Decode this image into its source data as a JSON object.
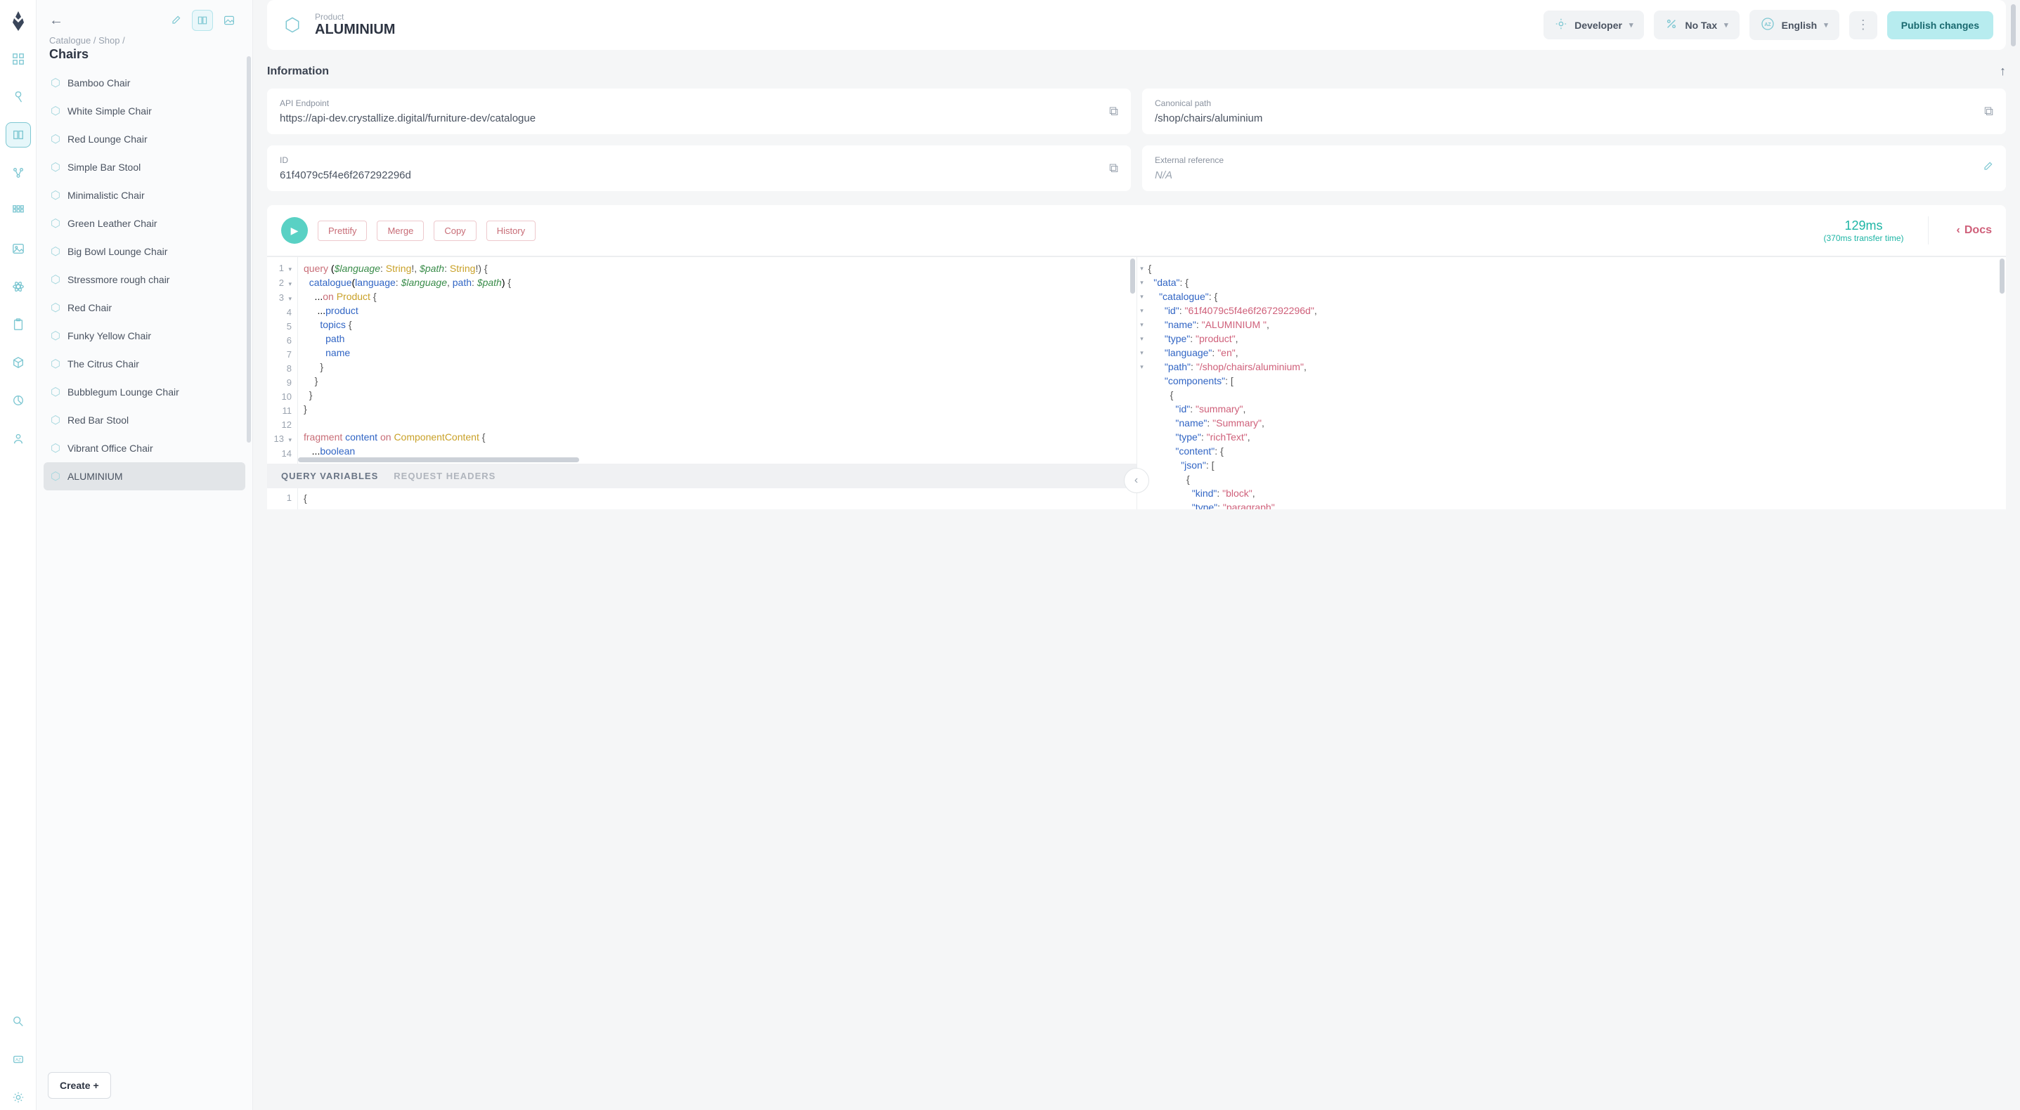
{
  "breadcrumb": {
    "a": "Catalogue",
    "b": "Shop",
    "title": "Chairs"
  },
  "sidebar": {
    "items": [
      {
        "label": "Bamboo Chair"
      },
      {
        "label": "White Simple Chair"
      },
      {
        "label": "Red Lounge Chair"
      },
      {
        "label": "Simple Bar Stool"
      },
      {
        "label": "Minimalistic Chair"
      },
      {
        "label": "Green Leather Chair"
      },
      {
        "label": "Big Bowl Lounge Chair"
      },
      {
        "label": "Stressmore rough chair"
      },
      {
        "label": "Red Chair"
      },
      {
        "label": "Funky Yellow Chair"
      },
      {
        "label": "The Citrus Chair"
      },
      {
        "label": "Bubblegum Lounge Chair"
      },
      {
        "label": "Red Bar Stool"
      },
      {
        "label": "Vibrant Office Chair"
      },
      {
        "label": "ALUMINIUM"
      }
    ],
    "create": "Create +"
  },
  "header": {
    "sub": "Product",
    "title": "ALUMINIUM",
    "developer": "Developer",
    "notax": "No Tax",
    "english": "English",
    "publish": "Publish changes"
  },
  "info": {
    "title": "Information",
    "apiEndpoint": {
      "label": "API Endpoint",
      "value": "https://api-dev.crystallize.digital/furniture-dev/catalogue"
    },
    "canonical": {
      "label": "Canonical path",
      "value": "/shop/chairs/aluminium"
    },
    "id": {
      "label": "ID",
      "value": "61f4079c5f4e6f267292296d"
    },
    "extref": {
      "label": "External reference",
      "value": "N/A"
    }
  },
  "gql": {
    "prettify": "Prettify",
    "merge": "Merge",
    "copy": "Copy",
    "history": "History",
    "time": "129ms",
    "transfer": "(370ms transfer time)",
    "docs": "Docs",
    "queryVars": "QUERY VARIABLES",
    "reqHeaders": "REQUEST HEADERS"
  }
}
